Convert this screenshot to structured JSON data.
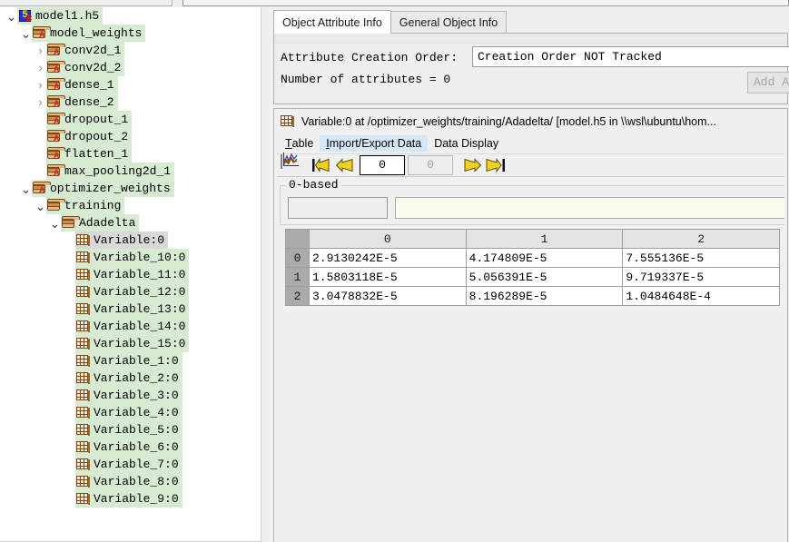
{
  "tree": {
    "items": [
      {
        "label": "model1.h5",
        "indent": 0,
        "icon": "hdf5-file-icon",
        "twisty": "expanded",
        "selected": false
      },
      {
        "label": "model_weights",
        "indent": 1,
        "icon": "folder-group-icon",
        "twisty": "expanded",
        "selected": false
      },
      {
        "label": "conv2d_1",
        "indent": 2,
        "icon": "folder-group-icon",
        "twisty": "collapsed",
        "selected": false
      },
      {
        "label": "conv2d_2",
        "indent": 2,
        "icon": "folder-group-icon",
        "twisty": "collapsed",
        "selected": false
      },
      {
        "label": "dense_1",
        "indent": 2,
        "icon": "folder-group-icon",
        "twisty": "collapsed",
        "selected": false
      },
      {
        "label": "dense_2",
        "indent": 2,
        "icon": "folder-group-icon",
        "twisty": "collapsed",
        "selected": false
      },
      {
        "label": "dropout_1",
        "indent": 2,
        "icon": "folder-group-icon",
        "twisty": "none",
        "selected": false
      },
      {
        "label": "dropout_2",
        "indent": 2,
        "icon": "folder-group-icon",
        "twisty": "none",
        "selected": false
      },
      {
        "label": "flatten_1",
        "indent": 2,
        "icon": "folder-group-icon",
        "twisty": "none",
        "selected": false
      },
      {
        "label": "max_pooling2d_1",
        "indent": 2,
        "icon": "folder-group-icon",
        "twisty": "none",
        "selected": false
      },
      {
        "label": "optimizer_weights",
        "indent": 1,
        "icon": "folder-group-icon",
        "twisty": "expanded",
        "selected": false
      },
      {
        "label": "training",
        "indent": 2,
        "icon": "folder-plain-icon",
        "twisty": "expanded",
        "selected": false
      },
      {
        "label": "Adadelta",
        "indent": 3,
        "icon": "folder-plain-icon",
        "twisty": "expanded",
        "selected": false
      },
      {
        "label": "Variable:0",
        "indent": 4,
        "icon": "dataset-icon",
        "twisty": "none",
        "selected": true
      },
      {
        "label": "Variable_10:0",
        "indent": 4,
        "icon": "dataset-icon",
        "twisty": "none",
        "selected": false
      },
      {
        "label": "Variable_11:0",
        "indent": 4,
        "icon": "dataset-icon",
        "twisty": "none",
        "selected": false
      },
      {
        "label": "Variable_12:0",
        "indent": 4,
        "icon": "dataset-icon",
        "twisty": "none",
        "selected": false
      },
      {
        "label": "Variable_13:0",
        "indent": 4,
        "icon": "dataset-icon",
        "twisty": "none",
        "selected": false
      },
      {
        "label": "Variable_14:0",
        "indent": 4,
        "icon": "dataset-icon",
        "twisty": "none",
        "selected": false
      },
      {
        "label": "Variable_15:0",
        "indent": 4,
        "icon": "dataset-icon",
        "twisty": "none",
        "selected": false
      },
      {
        "label": "Variable_1:0",
        "indent": 4,
        "icon": "dataset-icon",
        "twisty": "none",
        "selected": false
      },
      {
        "label": "Variable_2:0",
        "indent": 4,
        "icon": "dataset-icon",
        "twisty": "none",
        "selected": false
      },
      {
        "label": "Variable_3:0",
        "indent": 4,
        "icon": "dataset-icon",
        "twisty": "none",
        "selected": false
      },
      {
        "label": "Variable_4:0",
        "indent": 4,
        "icon": "dataset-icon",
        "twisty": "none",
        "selected": false
      },
      {
        "label": "Variable_5:0",
        "indent": 4,
        "icon": "dataset-icon",
        "twisty": "none",
        "selected": false
      },
      {
        "label": "Variable_6:0",
        "indent": 4,
        "icon": "dataset-icon",
        "twisty": "none",
        "selected": false
      },
      {
        "label": "Variable_7:0",
        "indent": 4,
        "icon": "dataset-icon",
        "twisty": "none",
        "selected": false
      },
      {
        "label": "Variable_8:0",
        "indent": 4,
        "icon": "dataset-icon",
        "twisty": "none",
        "selected": false
      },
      {
        "label": "Variable_9:0",
        "indent": 4,
        "icon": "dataset-icon",
        "twisty": "none",
        "selected": false
      }
    ]
  },
  "info_panel": {
    "tabs": [
      {
        "label": "Object Attribute Info",
        "active": true
      },
      {
        "label": "General Object Info",
        "active": false
      }
    ],
    "creation_order_label": "Attribute Creation Order:",
    "creation_order_value": "Creation Order NOT Tracked",
    "attribute_count_text": "Number of attributes = 0",
    "add_attribute_label": "Add At"
  },
  "data_view": {
    "title": "Variable:0  at  /optimizer_weights/training/Adadelta/  [model.h5  in  \\\\wsl\\ubuntu\\hom...",
    "menu": [
      {
        "label": "Table",
        "mnemonic": "T",
        "hover": false
      },
      {
        "label": "Import/Export Data",
        "mnemonic": "I",
        "hover": true
      },
      {
        "label": "Data Display",
        "mnemonic": "",
        "hover": false
      }
    ],
    "toolbar": {
      "chart_tooltip": "chart-icon",
      "first_page_label": "first-page",
      "prev_page_label": "previous-page",
      "page_current": "0",
      "page_total": "0",
      "next_page_label": "next-page",
      "last_page_label": "last-page"
    },
    "index_group_label": "0-based",
    "cell_reference_value": "",
    "formula_value": ""
  },
  "table_data": {
    "type": "table",
    "column_headers": [
      "0",
      "1",
      "2"
    ],
    "row_headers": [
      "0",
      "1",
      "2"
    ],
    "rows": [
      [
        "2.9130242E-5",
        "4.174809E-5",
        "7.555136E-5"
      ],
      [
        "1.5803118E-5",
        "5.056391E-5",
        "9.719337E-5"
      ],
      [
        "3.0478832E-5",
        "8.196289E-5",
        "1.0484648E-4"
      ]
    ]
  },
  "colors": {
    "tree_node_bg": "#d7ebd3",
    "tree_selected_bg": "#d9d9d9",
    "menu_hover_bg": "#d5e8f7",
    "arrow_yellow": "#f2d022",
    "formula_bg": "#fbfbec",
    "row_header_bg": "#aaaaaa",
    "panel_bg": "#f0f0f0"
  }
}
